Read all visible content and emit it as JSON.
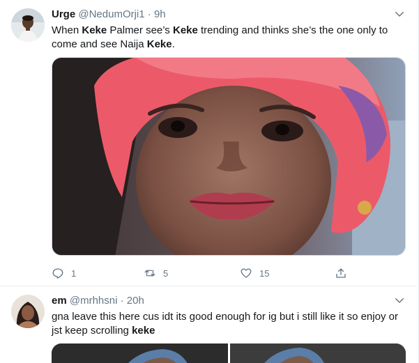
{
  "tweets": [
    {
      "display_name": "Urge",
      "handle": "@NedumOrji1",
      "separator": "·",
      "time": "9h",
      "text_segments": [
        {
          "t": "When ",
          "bold": false
        },
        {
          "t": "Keke",
          "bold": true
        },
        {
          "t": " Palmer see’s ",
          "bold": false
        },
        {
          "t": "Keke",
          "bold": true
        },
        {
          "t": " trending and thinks she’s the one only to come and see Naija ",
          "bold": false
        },
        {
          "t": "Keke",
          "bold": true
        },
        {
          "t": ".",
          "bold": false
        }
      ],
      "reply_count": "1",
      "retweet_count": "5",
      "like_count": "15"
    },
    {
      "display_name": "em",
      "handle": "@mrhhsni",
      "separator": "·",
      "time": "20h",
      "text_segments": [
        {
          "t": "gna leave this here cus idt its good enough for ig but i still like it so enjoy or jst keep scrolling ",
          "bold": false
        },
        {
          "t": "keke",
          "bold": true
        }
      ]
    }
  ],
  "icons": {
    "more": "chevron-down-icon",
    "reply": "reply-icon",
    "retweet": "retweet-icon",
    "like": "heart-icon",
    "share": "share-icon"
  },
  "colors": {
    "secondary_text": "#657786",
    "border": "#e6ecf0"
  }
}
